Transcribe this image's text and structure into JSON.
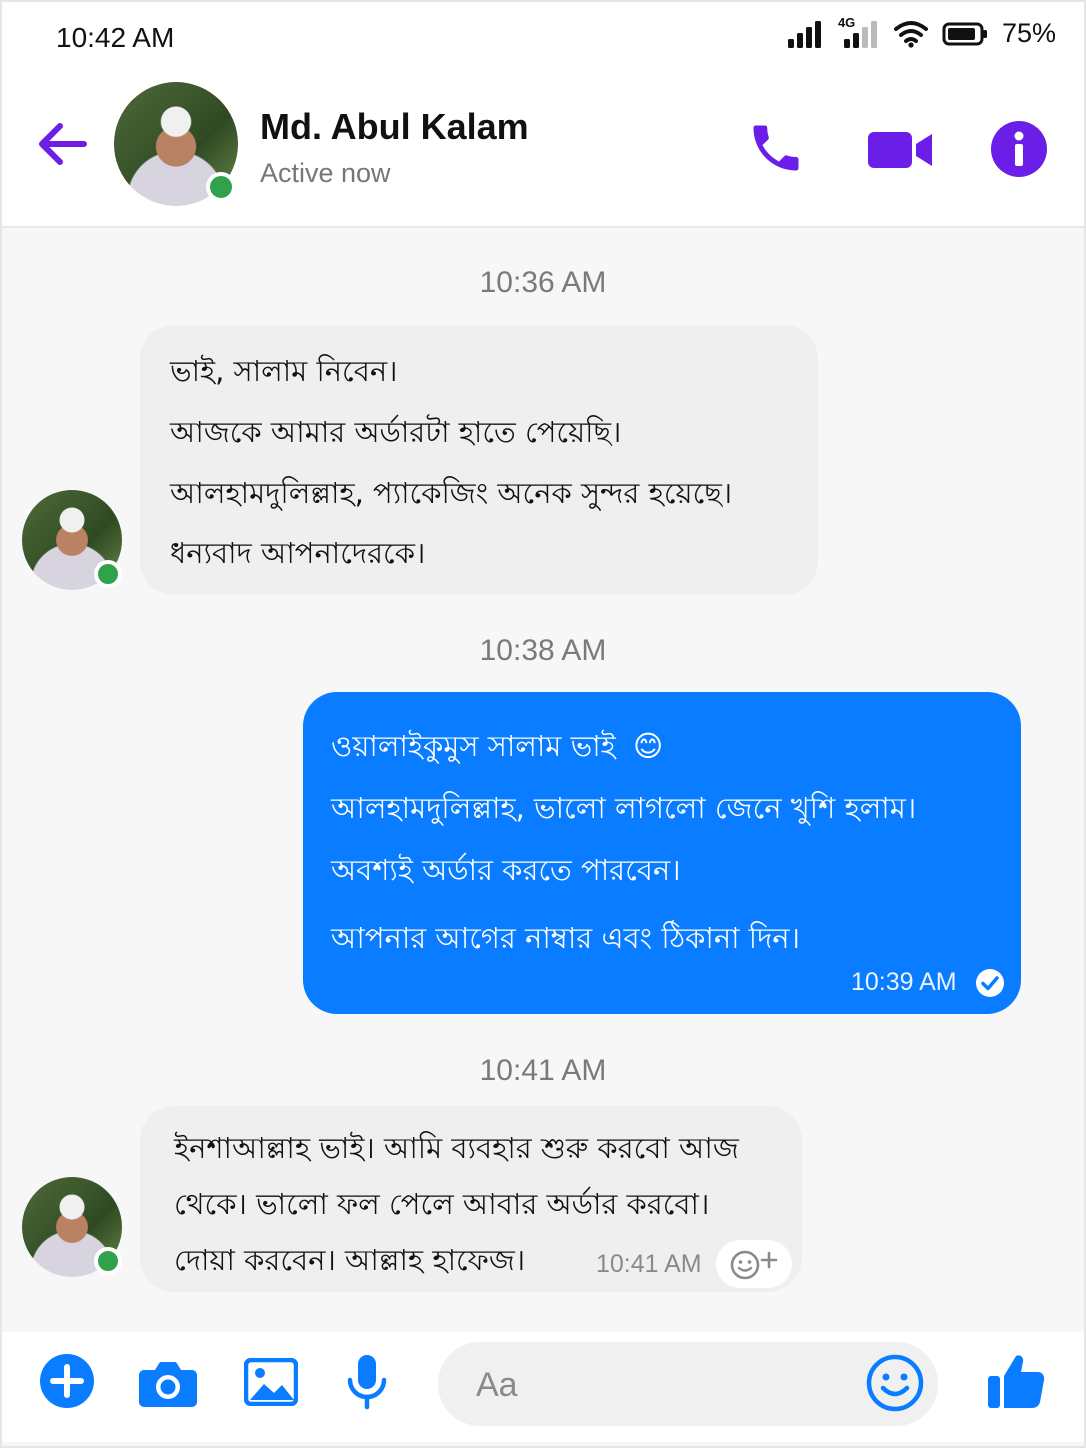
{
  "status_bar": {
    "time": "10:42 AM",
    "network": "4G",
    "battery": "75%",
    "icons": [
      "signal-icon",
      "4g-signal-icon",
      "wifi-icon",
      "battery-icon"
    ]
  },
  "header": {
    "contact_name": "Md. Abul Kalam",
    "contact_status": "Active now",
    "icons": [
      "back-arrow-icon",
      "phone-icon",
      "video-camera-icon",
      "info-icon"
    ]
  },
  "conversation": {
    "groups": [
      {
        "timestamp": "10:36 AM",
        "direction": "incoming",
        "lines": [
          "ভাই, সালাম নিবেন।",
          "আজকে আমার অর্ডারটা হাতে পেয়েছি।",
          "আলহামদুলিল্লাহ, প্যাকেজিং অনেক সুন্দর হয়েছে।",
          "ধন্যবাদ আপনাদেরকে।"
        ]
      },
      {
        "timestamp": "10:38 AM",
        "direction": "outgoing",
        "lines": [
          "ওয়ালাইকুমুস সালাম ভাই",
          "আলহামদুলিল্লাহ, ভালো লাগলো জেনে খুশি হলাম।",
          "অবশ্যই অর্ডার করতে পারবেন।",
          "আপনার আগের নাম্বার এবং ঠিকানা দিন।"
        ],
        "emoji": "😊",
        "sent_time": "10:39 AM",
        "receipt_icon": "check-circle-icon"
      },
      {
        "timestamp": "10:41 AM",
        "direction": "incoming",
        "lines": [
          "ইনশাআল্লাহ ভাই। আমি ব্যবহার শুরু করবো আজ",
          "থেকে। ভালো ফল পেলে আবার অর্ডার করবো।",
          "দোয়া করবেন। আল্লাহ হাফেজ।"
        ],
        "sent_time": "10:41 AM",
        "reaction_icon": "add-reaction-icon"
      }
    ]
  },
  "composer": {
    "placeholder": "Aa",
    "icons": [
      "plus-circle-icon",
      "camera-icon",
      "image-icon",
      "microphone-icon",
      "emoji-icon",
      "thumbs-up-icon"
    ]
  },
  "colors": {
    "accent": "#6b1ee8",
    "outgoing_bubble": "#0a7cff",
    "incoming_bubble": "#efefef",
    "online_dot": "#31a24c"
  }
}
